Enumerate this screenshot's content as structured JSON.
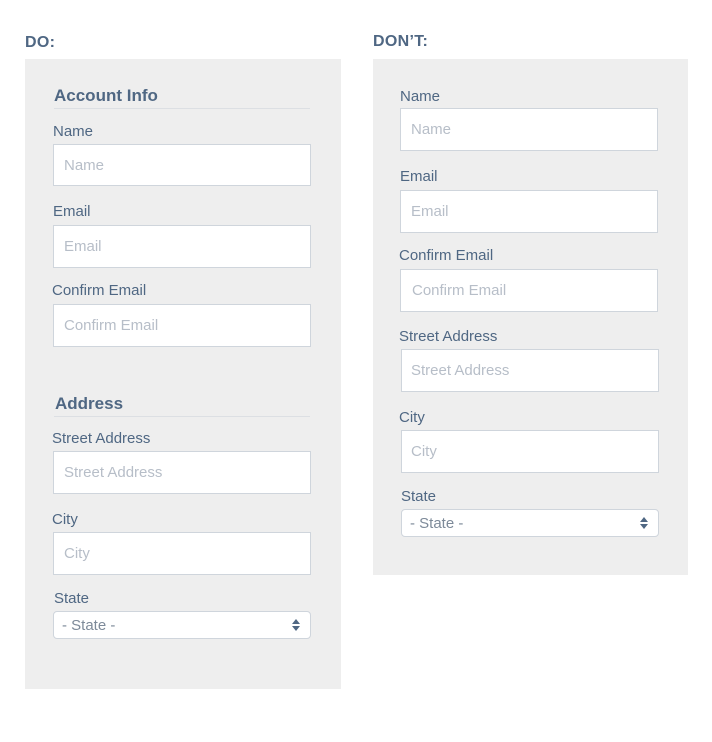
{
  "do": {
    "heading": "DO:",
    "sections": {
      "account": "Account Info",
      "address": "Address"
    },
    "fields": {
      "name": {
        "label": "Name",
        "placeholder": "Name"
      },
      "email": {
        "label": "Email",
        "placeholder": "Email"
      },
      "confirm_email": {
        "label": "Confirm Email",
        "placeholder": "Confirm Email"
      },
      "street": {
        "label": "Street Address",
        "placeholder": "Street Address"
      },
      "city": {
        "label": "City",
        "placeholder": "City"
      },
      "state": {
        "label": "State",
        "value": "- State -"
      }
    }
  },
  "dont": {
    "heading": "DON’T:",
    "fields": {
      "name": {
        "label": "Name",
        "placeholder": "Name"
      },
      "email": {
        "label": "Email",
        "placeholder": "Email"
      },
      "confirm_email": {
        "label": "Confirm Email",
        "placeholder": "Confirm Email"
      },
      "street": {
        "label": "Street Address",
        "placeholder": "Street Address"
      },
      "city": {
        "label": "City",
        "placeholder": "City"
      },
      "state": {
        "label": "State",
        "value": "- State -"
      }
    }
  }
}
